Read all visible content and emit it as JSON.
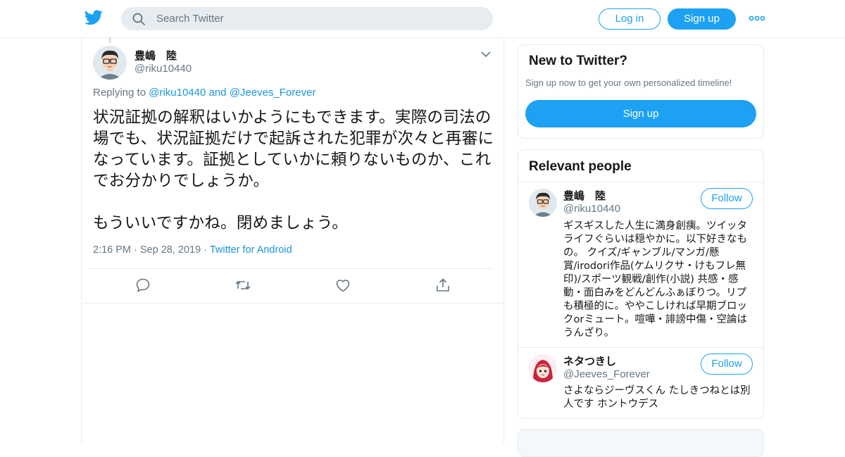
{
  "header": {
    "logo_icon": "twitter-bird-icon",
    "search_placeholder": "Search Twitter",
    "login_label": "Log in",
    "signup_label": "Sign up",
    "more_icon": "more-dots-icon",
    "brand_color": "#1da1f2"
  },
  "tweet": {
    "author_name": "豊嶋　陸",
    "author_handle": "@riku10440",
    "replying_prefix": "Replying to",
    "replying_to_1": "@riku10440",
    "replying_and": "and",
    "replying_to_2": "@Jeeves_Forever",
    "text": "状況証拠の解釈はいかようにもできます。実際の司法の場でも、状況証拠だけで起訴された犯罪が次々と再審になっています。証拠としていかに頼りないものか、これでお分かりでしょうか。\n\nもういいですかね。閉めましょう。",
    "time": "2:16 PM",
    "date": "Sep 28, 2019",
    "source": "Twitter for Android",
    "actions": [
      "reply-icon",
      "retweet-icon",
      "like-icon",
      "share-icon"
    ]
  },
  "sidebar": {
    "new_card": {
      "title": "New to Twitter?",
      "subtitle": "Sign up now to get your own personalized timeline!",
      "button": "Sign up"
    },
    "relevant": {
      "title": "Relevant people",
      "people": [
        {
          "name": "豊嶋　陸",
          "handle": "@riku10440",
          "follow": "Follow",
          "bio": "ギスギスした人生に満身創痍。ツイッタライフぐらいは穏やかに。以下好きなもの。 クイズ/ギャンブル/マンガ/懸賞/irodori作品(ケムリクサ・けもフレ無印)/スポーツ観戦/創作(小説) 共感・感動・面白みをどんどんふぁぼりつ。リプも積極的に。ややこしければ早期ブロックorミュート。喧嘩・誹謗中傷・空論はうんざり。"
        },
        {
          "name": "ネタつきし",
          "handle": "@Jeeves_Forever",
          "follow": "Follow",
          "bio": "さよならジーヴスくん たしきつねとは別人です ホントウデス"
        }
      ]
    }
  }
}
